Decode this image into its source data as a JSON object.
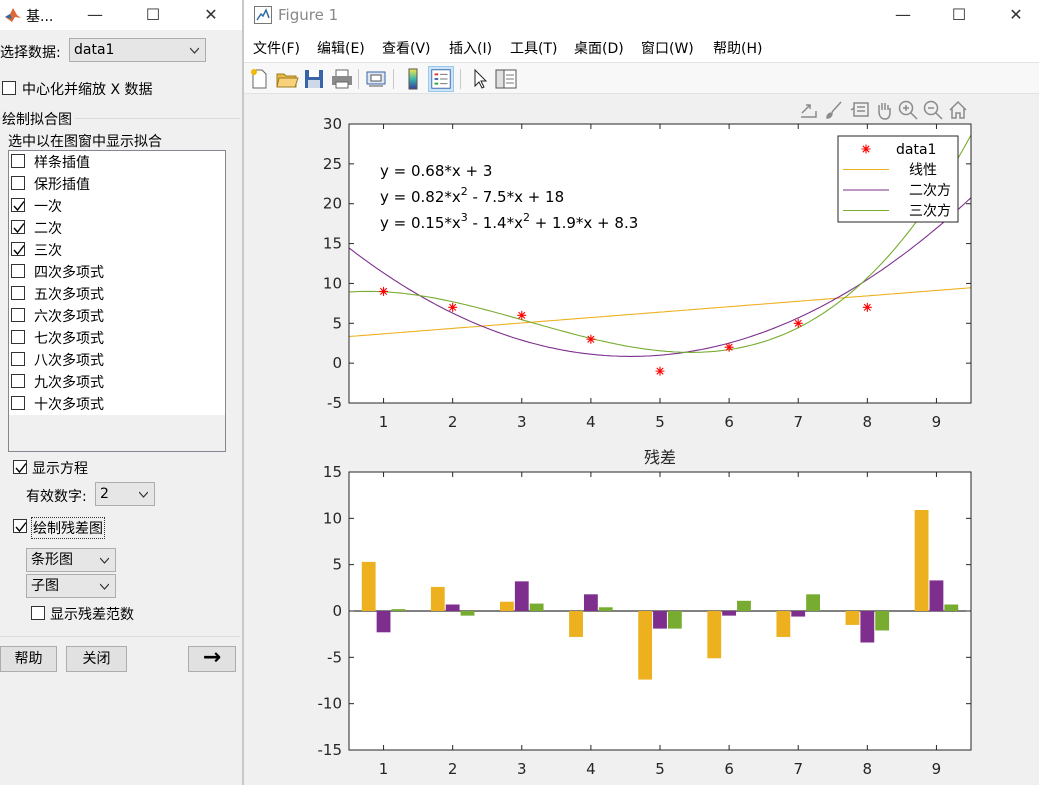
{
  "basic_fitting": {
    "title": "基...",
    "window_controls": [
      "—",
      "☐",
      "✕"
    ],
    "select_data_label": "选择数据:",
    "select_data_value": "data1",
    "center_scale_label": "中心化并缩放 X 数据",
    "center_scale_checked": false,
    "plot_fits_heading": "绘制拟合图",
    "plot_fits_hint": "选中以在图窗中显示拟合",
    "fits": [
      {
        "label": "样条插值",
        "checked": false
      },
      {
        "label": "保形插值",
        "checked": false
      },
      {
        "label": "一次",
        "checked": true
      },
      {
        "label": "二次",
        "checked": true
      },
      {
        "label": "三次",
        "checked": true
      },
      {
        "label": "四次多项式",
        "checked": false
      },
      {
        "label": "五次多项式",
        "checked": false
      },
      {
        "label": "六次多项式",
        "checked": false
      },
      {
        "label": "七次多项式",
        "checked": false
      },
      {
        "label": "八次多项式",
        "checked": false
      },
      {
        "label": "九次多项式",
        "checked": false
      },
      {
        "label": "十次多项式",
        "checked": false
      }
    ],
    "show_equations_label": "显示方程",
    "show_equations_checked": true,
    "sig_digits_label": "有效数字:",
    "sig_digits_value": "2",
    "plot_residuals_label": "绘制残差图",
    "plot_residuals_checked": true,
    "residual_plot_type": "条形图",
    "residual_plot_location": "子图",
    "show_residual_norm_label": "显示残差范数",
    "show_residual_norm_checked": false,
    "help_button": "帮助",
    "close_button": "关闭",
    "forward_button": "→"
  },
  "figure": {
    "title": "Figure 1",
    "window_controls": [
      "—",
      "☐",
      "✕"
    ],
    "menu": [
      "文件(F)",
      "编辑(E)",
      "查看(V)",
      "插入(I)",
      "工具(T)",
      "桌面(D)",
      "窗口(W)",
      "帮助(H)"
    ],
    "toolbar_icons": [
      "new-figure-icon",
      "open-file-icon",
      "save-icon",
      "print-icon",
      "link-plot-icon",
      "colorbar-icon",
      "legend-icon",
      "pointer-icon",
      "property-editor-icon"
    ],
    "axes_toolbar_icons": [
      "export-icon",
      "brush-icon",
      "datatip-icon",
      "pan-icon",
      "zoom-in-icon",
      "zoom-out-icon",
      "home-icon"
    ],
    "colors": {
      "data": "#ff0000",
      "linear": "#edb120",
      "quadratic": "#7e2f8e",
      "cubic": "#77ac30"
    }
  },
  "chart_data": [
    {
      "type": "scatter+line",
      "title": "",
      "xlim": [
        0.5,
        9.5
      ],
      "ylim": [
        -5,
        30
      ],
      "x_ticks": [
        1,
        2,
        3,
        4,
        5,
        6,
        7,
        8,
        9
      ],
      "y_ticks": [
        -5,
        0,
        5,
        10,
        15,
        20,
        25,
        30
      ],
      "data_points": {
        "name": "data1",
        "x": [
          1,
          2,
          3,
          4,
          5,
          6,
          7,
          8
        ],
        "y": [
          9,
          7,
          6,
          3,
          -1,
          2,
          5,
          7
        ]
      },
      "fits": [
        {
          "name": "线性",
          "coeffs": [
            0.68,
            3
          ]
        },
        {
          "name": "二次方",
          "coeffs": [
            0.82,
            -7.5,
            18
          ]
        },
        {
          "name": "三次方",
          "coeffs": [
            0.15,
            -1.4,
            1.9,
            8.3
          ]
        }
      ],
      "equations": [
        {
          "prefix": "y = 0.68*x + 3"
        },
        {
          "prefix": "y = 0.82*x",
          "sup": "2",
          "suffix": " - 7.5*x + 18"
        },
        {
          "prefix": "y = 0.15*x",
          "sup": "3",
          "mid": " - 1.4*x",
          "sup2": "2",
          "suffix": " + 1.9*x + 8.3"
        }
      ],
      "legend": {
        "location": "top-right",
        "entries": [
          "data1",
          "线性",
          "二次方",
          "三次方"
        ]
      }
    },
    {
      "type": "bar",
      "title": "残差",
      "xlim": [
        0.5,
        9.5
      ],
      "ylim": [
        -15,
        15
      ],
      "x_ticks": [
        1,
        2,
        3,
        4,
        5,
        6,
        7,
        8,
        9
      ],
      "y_ticks": [
        -15,
        -10,
        -5,
        0,
        5,
        10,
        15
      ],
      "categories": [
        1,
        2,
        3,
        4,
        5,
        6,
        7,
        8,
        9
      ],
      "series": [
        {
          "values": [
            5.3,
            2.6,
            1.0,
            -2.8,
            -7.4,
            -5.1,
            -2.8,
            -1.5,
            10.9
          ]
        },
        {
          "values": [
            -2.3,
            0.7,
            3.2,
            1.8,
            -1.9,
            -0.5,
            -0.6,
            -3.4,
            3.3
          ]
        },
        {
          "values": [
            0.2,
            -0.5,
            0.8,
            0.4,
            -1.9,
            1.1,
            1.8,
            -2.1,
            0.7
          ]
        }
      ]
    }
  ]
}
